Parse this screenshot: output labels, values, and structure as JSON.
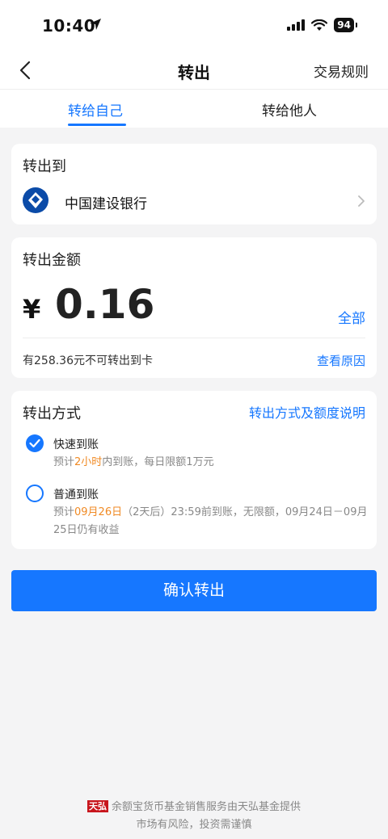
{
  "status_bar": {
    "time": "10:40",
    "battery": "94"
  },
  "nav": {
    "title": "转出",
    "right_label": "交易规则"
  },
  "tabs": [
    {
      "label": "转给自己",
      "active": true
    },
    {
      "label": "转给他人",
      "active": false
    }
  ],
  "destination": {
    "title": "转出到",
    "bank_name": "中国建设银行"
  },
  "amount_card": {
    "title": "转出金额",
    "currency": "¥",
    "amount": "0.16",
    "all_label": "全部",
    "note": "有258.36元不可转出到卡",
    "reason_label": "查看原因"
  },
  "method_card": {
    "title": "转出方式",
    "help_label": "转出方式及额度说明",
    "options": [
      {
        "title": "快速到账",
        "desc_prefix": "预计",
        "desc_highlight": "2小时",
        "desc_suffix": "内到账，每日限额1万元",
        "selected": true
      },
      {
        "title": "普通到账",
        "desc_prefix": "预计",
        "desc_highlight": "09月26日",
        "desc_suffix": "（2天后）23:59前到账，无限额，09月24日－09月25日仍有收益",
        "selected": false
      }
    ]
  },
  "confirm_label": "确认转出",
  "footer": {
    "logo_text": "天弘",
    "line1": "余额宝货币基金销售服务由天弘基金提供",
    "line2": "市场有风险，投资需谨慎"
  },
  "colors": {
    "accent": "#1677ff",
    "highlight": "#f08a24",
    "background": "#f4f4f5"
  }
}
